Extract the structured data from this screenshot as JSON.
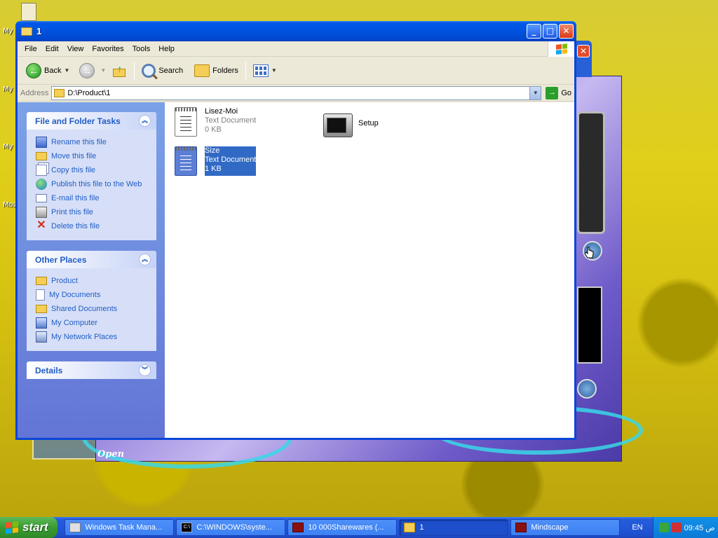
{
  "desktop": {
    "icon_labels": [
      "My",
      "My",
      "My",
      "Moz"
    ]
  },
  "background_app": {
    "open_label": "Open"
  },
  "window": {
    "title": "1",
    "buttons": {
      "minimize": "_",
      "maximize": "□",
      "close": "✕"
    }
  },
  "menubar": {
    "items": [
      "File",
      "Edit",
      "View",
      "Favorites",
      "Tools",
      "Help"
    ]
  },
  "toolbar": {
    "back_label": "Back",
    "search_label": "Search",
    "folders_label": "Folders"
  },
  "address": {
    "label": "Address",
    "value": "D:\\Product\\1",
    "go_label": "Go"
  },
  "file_tasks": {
    "title": "File and Folder Tasks",
    "items": [
      "Rename this file",
      "Move this file",
      "Copy this file",
      "Publish this file to the Web",
      "E-mail this file",
      "Print this file",
      "Delete this file"
    ]
  },
  "other_places": {
    "title": "Other Places",
    "items": [
      "Product",
      "My Documents",
      "Shared Documents",
      "My Computer",
      "My Network Places"
    ]
  },
  "details": {
    "title": "Details"
  },
  "files": [
    {
      "name": "Lisez-Moi",
      "type": "Text Document",
      "size": "0 KB"
    },
    {
      "name": "Setup"
    },
    {
      "name": "Size",
      "type": "Text Document",
      "size": "1 KB",
      "selected": true
    }
  ],
  "taskbar": {
    "start_label": "start",
    "tasks": [
      "Windows Task Mana...",
      "C:\\WINDOWS\\syste...",
      "10 000Sharewares (...",
      "1",
      "Mindscape"
    ],
    "language": "EN",
    "clock": "09:45 ص"
  },
  "colors": {
    "xp_blue": "#0a46d8",
    "task_link": "#215dc6",
    "selection": "#316ac5",
    "start_green": "#3a9a32"
  }
}
